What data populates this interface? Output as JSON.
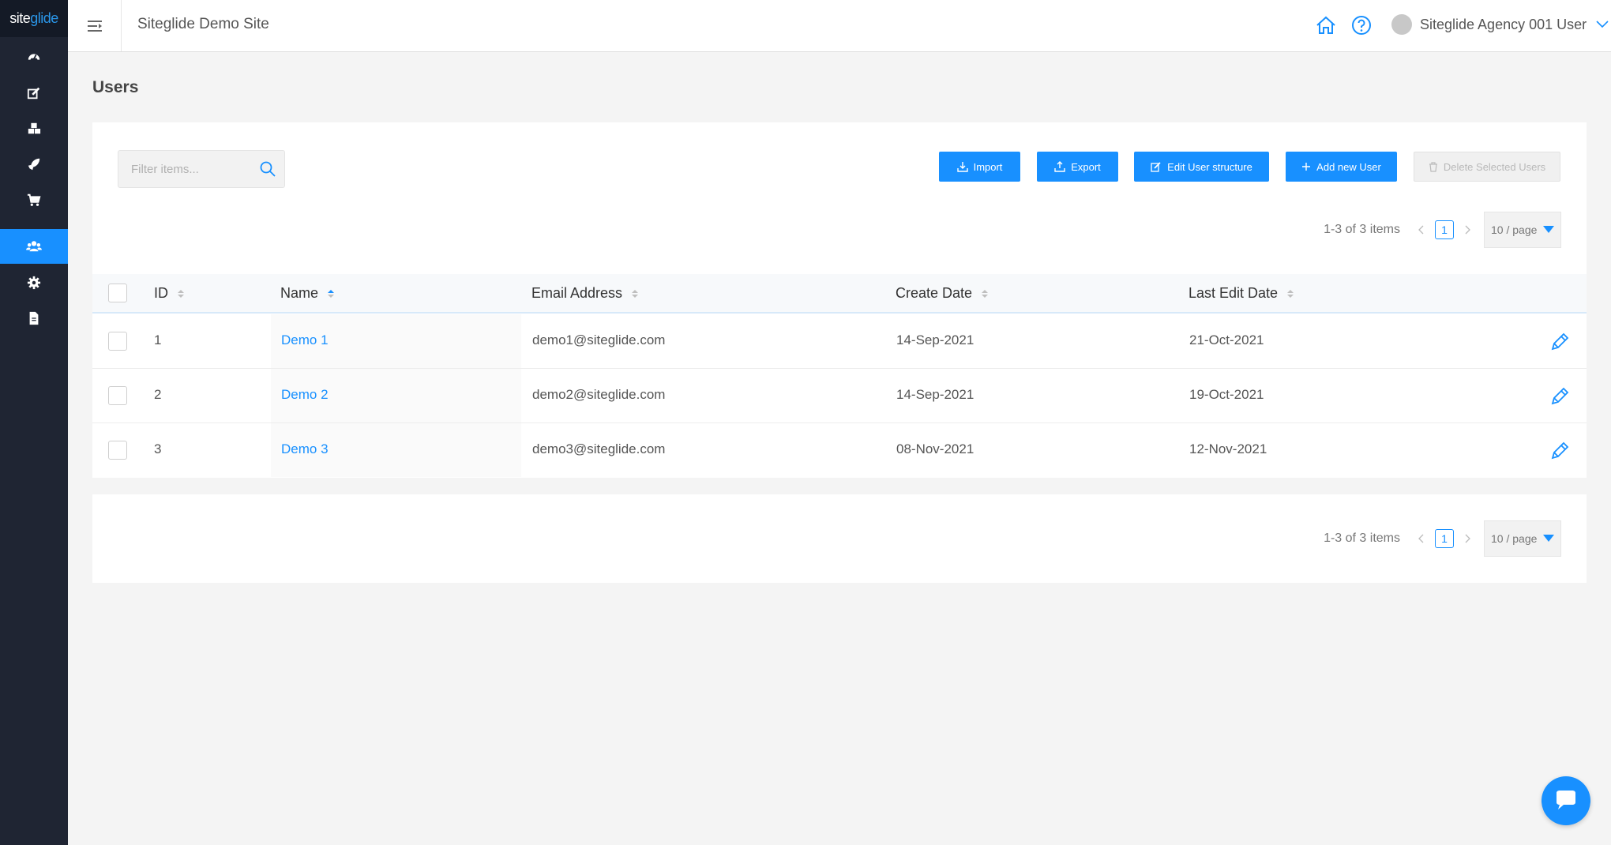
{
  "brand": {
    "logo_prefix": "site",
    "logo_suffix": "glide"
  },
  "sidebar": {
    "items": [
      {
        "name": "dashboard",
        "icon": "dashboard-icon",
        "active": false
      },
      {
        "name": "cms",
        "icon": "edit-icon",
        "active": false
      },
      {
        "name": "modules",
        "icon": "cubes-icon",
        "active": false
      },
      {
        "name": "publish",
        "icon": "rocket-icon",
        "active": false
      },
      {
        "name": "ecommerce",
        "icon": "cart-icon",
        "active": false
      },
      {
        "name": "users",
        "icon": "users-icon",
        "active": true
      },
      {
        "name": "settings",
        "icon": "gear-icon",
        "active": false
      },
      {
        "name": "files",
        "icon": "file-icon",
        "active": false
      }
    ]
  },
  "header": {
    "site_name": "Siteglide Demo Site",
    "user_name": "Siteglide Agency 001 User",
    "icons": [
      "home-icon",
      "help-icon",
      "chevron-down-icon"
    ]
  },
  "page": {
    "title": "Users"
  },
  "toolbar": {
    "filter_placeholder": "Filter items...",
    "import": "Import",
    "export": "Export",
    "edit_structure": "Edit User structure",
    "add_new": "Add new User",
    "delete_selected": "Delete Selected Users"
  },
  "pagination": {
    "summary": "1-3 of 3 items",
    "current_page": "1",
    "page_size": "10 / page"
  },
  "table": {
    "columns": [
      "ID",
      "Name",
      "Email Address",
      "Create Date",
      "Last Edit Date"
    ],
    "rows": [
      {
        "id": "1",
        "name": "Demo 1",
        "email": "demo1@siteglide.com",
        "created": "14-Sep-2021",
        "edited": "21-Oct-2021"
      },
      {
        "id": "2",
        "name": "Demo 2",
        "email": "demo2@siteglide.com",
        "created": "14-Sep-2021",
        "edited": "19-Oct-2021"
      },
      {
        "id": "3",
        "name": "Demo 3",
        "email": "demo3@siteglide.com",
        "created": "08-Nov-2021",
        "edited": "12-Nov-2021"
      }
    ]
  },
  "colors": {
    "primary": "#1890ff",
    "sidebar": "#1f2533",
    "background": "#f4f4f4"
  }
}
